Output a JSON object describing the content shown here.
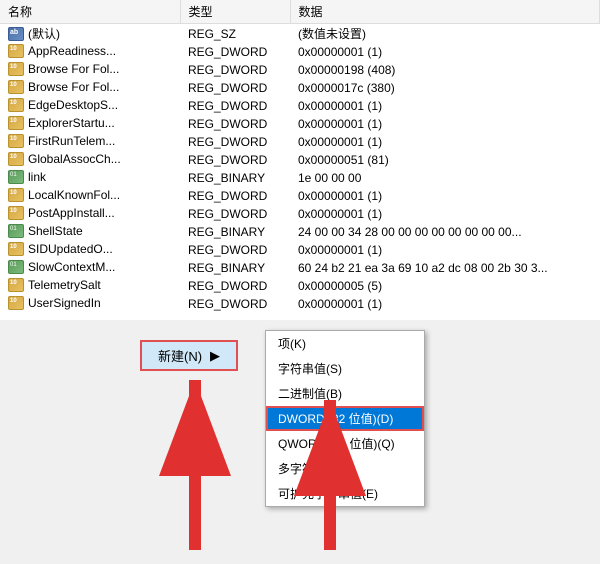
{
  "table": {
    "columns": [
      "名称",
      "类型",
      "数据"
    ],
    "rows": [
      {
        "icon": "ab",
        "name": "(默认)",
        "type": "REG_SZ",
        "data": "(数值未设置)"
      },
      {
        "icon": "dword",
        "name": "AppReadiness...",
        "type": "REG_DWORD",
        "data": "0x00000001 (1)"
      },
      {
        "icon": "dword",
        "name": "Browse For Fol...",
        "type": "REG_DWORD",
        "data": "0x00000198 (408)"
      },
      {
        "icon": "dword",
        "name": "Browse For Fol...",
        "type": "REG_DWORD",
        "data": "0x0000017c (380)"
      },
      {
        "icon": "dword",
        "name": "EdgeDesktopS...",
        "type": "REG_DWORD",
        "data": "0x00000001 (1)"
      },
      {
        "icon": "dword",
        "name": "ExplorerStartu...",
        "type": "REG_DWORD",
        "data": "0x00000001 (1)"
      },
      {
        "icon": "dword",
        "name": "FirstRunTelem...",
        "type": "REG_DWORD",
        "data": "0x00000001 (1)"
      },
      {
        "icon": "dword",
        "name": "GlobalAssocCh...",
        "type": "REG_DWORD",
        "data": "0x00000051 (81)"
      },
      {
        "icon": "binary",
        "name": "link",
        "type": "REG_BINARY",
        "data": "1e 00 00 00"
      },
      {
        "icon": "dword",
        "name": "LocalKnownFol...",
        "type": "REG_DWORD",
        "data": "0x00000001 (1)"
      },
      {
        "icon": "dword",
        "name": "PostAppInstall...",
        "type": "REG_DWORD",
        "data": "0x00000001 (1)"
      },
      {
        "icon": "binary",
        "name": "ShellState",
        "type": "REG_BINARY",
        "data": "24 00 00 34 28 00 00 00 00 00 00 00 00..."
      },
      {
        "icon": "dword",
        "name": "SIDUpdatedO...",
        "type": "REG_DWORD",
        "data": "0x00000001 (1)"
      },
      {
        "icon": "binary",
        "name": "SlowContextM...",
        "type": "REG_BINARY",
        "data": "60 24 b2 21 ea 3a 69 10 a2 dc 08 00 2b 30 3..."
      },
      {
        "icon": "dword",
        "name": "TelemetrySalt",
        "type": "REG_DWORD",
        "data": "0x00000005 (5)"
      },
      {
        "icon": "dword",
        "name": "UserSignedIn",
        "type": "REG_DWORD",
        "data": "0x00000001 (1)"
      }
    ]
  },
  "context_menu": {
    "new_label": "新建(N)",
    "arrow": "▶",
    "items": [
      {
        "label": "项(K)",
        "highlighted": false
      },
      {
        "label": "字符串值(S)",
        "highlighted": false
      },
      {
        "label": "二进制值(B)",
        "highlighted": false
      },
      {
        "label": "DWORD (32 位值)(D)",
        "highlighted": true
      },
      {
        "label": "QWORD (64 位值)(Q)",
        "highlighted": false
      },
      {
        "label": "多字符串值(M)",
        "highlighted": false
      },
      {
        "label": "可扩充字符串值(E)",
        "highlighted": false
      }
    ]
  },
  "colors": {
    "selected_bg": "#0078d7",
    "highlight_border": "#e05050",
    "menu_highlight": "#0078d7"
  }
}
